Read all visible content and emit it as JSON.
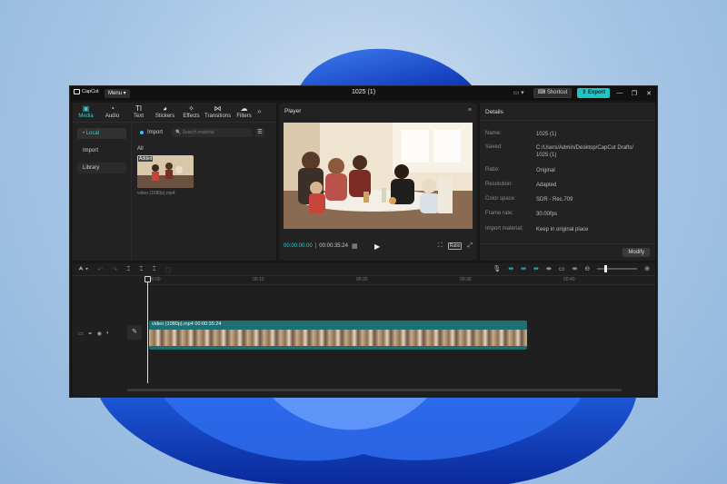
{
  "app": {
    "logo_text": "CapCut",
    "menu_label": "Menu",
    "project_title": "1025 (1)",
    "shortcut_label": "Shortcut",
    "export_label": "Export",
    "colors": {
      "accent": "#1fc4c4",
      "panel": "#222222",
      "background": "#181818"
    }
  },
  "media_panel": {
    "tabs": [
      {
        "label": "Media",
        "icon": "media-icon",
        "active": true
      },
      {
        "label": "Audio",
        "icon": "audio-icon"
      },
      {
        "label": "Text",
        "icon": "text-icon"
      },
      {
        "label": "Stickers",
        "icon": "sticker-icon"
      },
      {
        "label": "Effects",
        "icon": "effects-icon"
      },
      {
        "label": "Transitions",
        "icon": "transitions-icon"
      },
      {
        "label": "Filters",
        "icon": "filters-icon"
      }
    ],
    "nav": [
      "• Local",
      "Import",
      "Library"
    ],
    "import_label": "Import",
    "search_placeholder": "Search material",
    "filter_label": "All",
    "thumb_badge": "Added",
    "thumb_name": "video (1080p).mp4"
  },
  "player": {
    "title": "Player",
    "current_time": "00:00:00:00",
    "duration": "00:00:35:24",
    "ratio_label": "Ratio"
  },
  "details": {
    "title": "Details",
    "rows": [
      {
        "key": "Name:",
        "value": "1025 (1)"
      },
      {
        "key": "Saved:",
        "value": "C:/Users/Admin/Desktop/CapCut Drafts/ 1025 (1)"
      },
      {
        "key": "Ratio:",
        "value": "Original"
      },
      {
        "key": "Resolution:",
        "value": "Adapted"
      },
      {
        "key": "Color space:",
        "value": "SDR - Rec.709"
      },
      {
        "key": "Frame rate:",
        "value": "30.00fps"
      },
      {
        "key": "Import material:",
        "value": "Keep in original place"
      }
    ],
    "modify_label": "Modify"
  },
  "timeline": {
    "ruler_labels": [
      "00:00",
      "00:10",
      "00:20",
      "00:30",
      "00:40"
    ],
    "clip_label": "video (1080p).mp4   00:00:35:24"
  }
}
